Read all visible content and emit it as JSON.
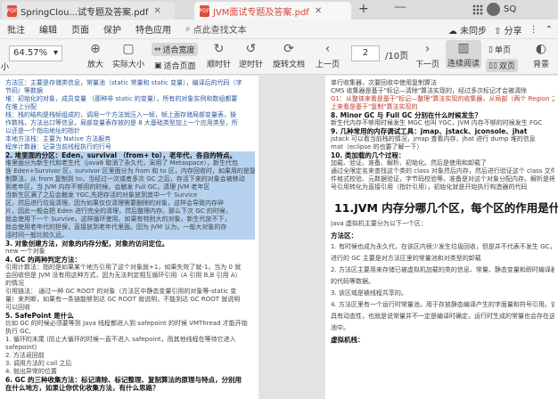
{
  "tabs": [
    {
      "label": "SpringClou...试专题及答案.pdf",
      "icon": "pdf-icon"
    },
    {
      "label": "JVM面试专题及答案.pdf",
      "icon": "pdf-icon"
    }
  ],
  "tabbar": {
    "new_tab": "+",
    "minus": "—",
    "user": "SQ"
  },
  "menu": {
    "items": [
      "批注",
      "编辑",
      "页面",
      "保护",
      "特色应用"
    ],
    "search": "点此查找文本",
    "right": [
      "未同步",
      "分享"
    ]
  },
  "toolbar": {
    "zoom": "64.57%",
    "zoom_in": "放大",
    "actual_size": "实际大小",
    "fit_width": "适合宽度",
    "fit_page": "适合页面",
    "rotate_cw": "顺时针",
    "rotate_ccw": "逆时针",
    "rotate_doc": "旋转文档",
    "prev_page": "上一页",
    "page_current": "2",
    "page_total": "/10页",
    "next_page": "下一页",
    "continuous_read": "连续阅读",
    "single_page": "单页",
    "double_page": "双页",
    "background": "背景",
    "small": "小"
  },
  "left_page": {
    "lines": [
      "方法区：主要是存储类信息，常量池（static 常量和 static 变量），编译后的代码（字",
      "节码）等数据",
      "堆：初始化的对象，成员变量 （那种非 static 的变量），所有的对象实例和数组都要",
      "在堆上分配",
      "栈：栈的结构是栈帧组成的，调用一个方法就压入一帧，帧上面存储局部变量表，操",
      "作数栈，方法出口等信息，局部变量表存放的是 8 大基础类型加上一个应用类型，所",
      "以还是一个指向地址的指针",
      "本地方法栈：主要为 Native 方法服务",
      "程序计数器：记录当前线程执行的行号",
      "2.  堆里面的分区：Eden，survival （from+ to），老年代，各自的特点。",
      "堆里面分为新生代和老生代（java8 取消了永久代，采用了 Metaspace），新生代包",
      "含 Eden+Survivor 区，survivor 区里面分为 from 和 to 区，内存回收时，如果用的是复",
      "制算法，从 from 复制到 to，当经过一次或者多次 GC 之后，存活下来的对象会被移动",
      "到老年区，当 JVM 内存不够用的时候，会触发 Full GC，清理 JVM 老年区",
      "当新生区满了之后会触发 YGC,先把存活的对象放到其中一个 Survice",
      "区，然后进行垃圾清理。因为如果仅仅清理需要删除的对象，这样会导致内存碎",
      "片，因此一般会把 Eden 进行完全的清理，然后整理内存。那么下次 GC 的时候，",
      "就会使用下一个 Survive，这样循环使用。如果有特别大的对象，新生代放不下，",
      "就会使用老年代的担保，直接放到老年代里面。因为 JVM 认为，一般大对象的存",
      "活时间一般比较久远。",
      "3.  对象创建方法，对象的内存分配，对象的访问定位。",
      "new 一个对象",
      "4.  GC 的两种判定方法：",
      "引用计数法：指的是如果某个地方引用了这个对象就+1，如果失效了就-1，当为 0 就",
      "会回收但是 JVM 没有用这种方式，因为无法判定相互循环引用（A 引用 B,B 引用 A）",
      "的情况",
      "引用链法：  通过一种 GC ROOT 的对象（方法区中静态变量引用的对象等-static 变",
      "量）来判断，如果有一条链能够到达 GC ROOT 就说明，不能到达 GC ROOT 就说明",
      "可以回收",
      "5.  SafePoint 是什么",
      "比如 GC 的时候必须要等到 Java 线程都进入到 safepoint 的时候 VMThread 才能开始",
      "执行 GC,",
      "1.  循环的末尾 (防止大循环的时候一直不进入 safepoint，而其他线程在等待它进入",
      "safepoint)",
      "2.  方法返回前",
      "3.  调用方法的 call 之后",
      "4.  抛出异常的位置",
      "6.  GC 的三种收集方法：标记清除、标记整理、复制算法的原理与特点，分别用",
      "在什么地方，如果让你优化收集方法，有什么思路？"
    ]
  },
  "right_page": {
    "lines": [
      "单行收集器，次要回收中使用复制算法",
      "CMS 收集器是基于\"标记—清除\"算法实现的，经过多次标记才会被清除",
      "G1：从整体来看是基于\"标记—整理\"算法实现的收集器，从局部（两个 Region 之间）",
      "上来看是基于\"复制\"算法实现的",
      "8.  Minor GC 与 Full GC 分别在什么时候发生？",
      "新生代内存不够用时候发生 MGC 也叫 YGC，JVM 内存不够的时候发生 FGC",
      "9.  几种常用的内存调试工具：jmap、jstack、jconsole、jhat",
      "jstack 可以看当前栈的情况，jmap 查看内存，jhat 进行 dump 堆的信息",
      "mat（eclipse 的也要了解一下）",
      "10. 类加载的几个过程：",
      "加载、验证、准备、解析、初始化。然后是使用和卸载了",
      "通过全限定名来查找这个类的 class 对象然后内存，然后进行验证这个 class 文件，包括文",
      "件格式校验、元数据验证，字节码校验等。准备是对这个对象分配内存。解析是将符",
      "号引用转化为直接引用（指针引用），初始化就是开始执行构造器的代码",
      "11.JVM 内存分哪几个区，每个区的作用是什么?",
      "java 虚拟机主要分为以下一个区：",
      "方法区：",
      "1. 有时候也成为永久代，在该区内很少发生垃圾回收，但是并不代表不发生 GC，在这里",
      "进行的 GC 主要是对方法区里的常量池和对类型的卸载",
      "2. 方法区主要用来存储已被虚拟机加载的类的信息、常量、静态变量和即时编译器编译后",
      "的代码等数据。",
      "3. 该区域是被线程共享的。",
      "4. 方法区里有一个运行时常量池，用于存放静态编译产生的字面量和符号引用。该常量池",
      "具有动态性，也就是说常量并不一定是编译时确定，运行时生成的常量也会存在这个常量",
      "池中。",
      "虚拟机栈："
    ]
  }
}
